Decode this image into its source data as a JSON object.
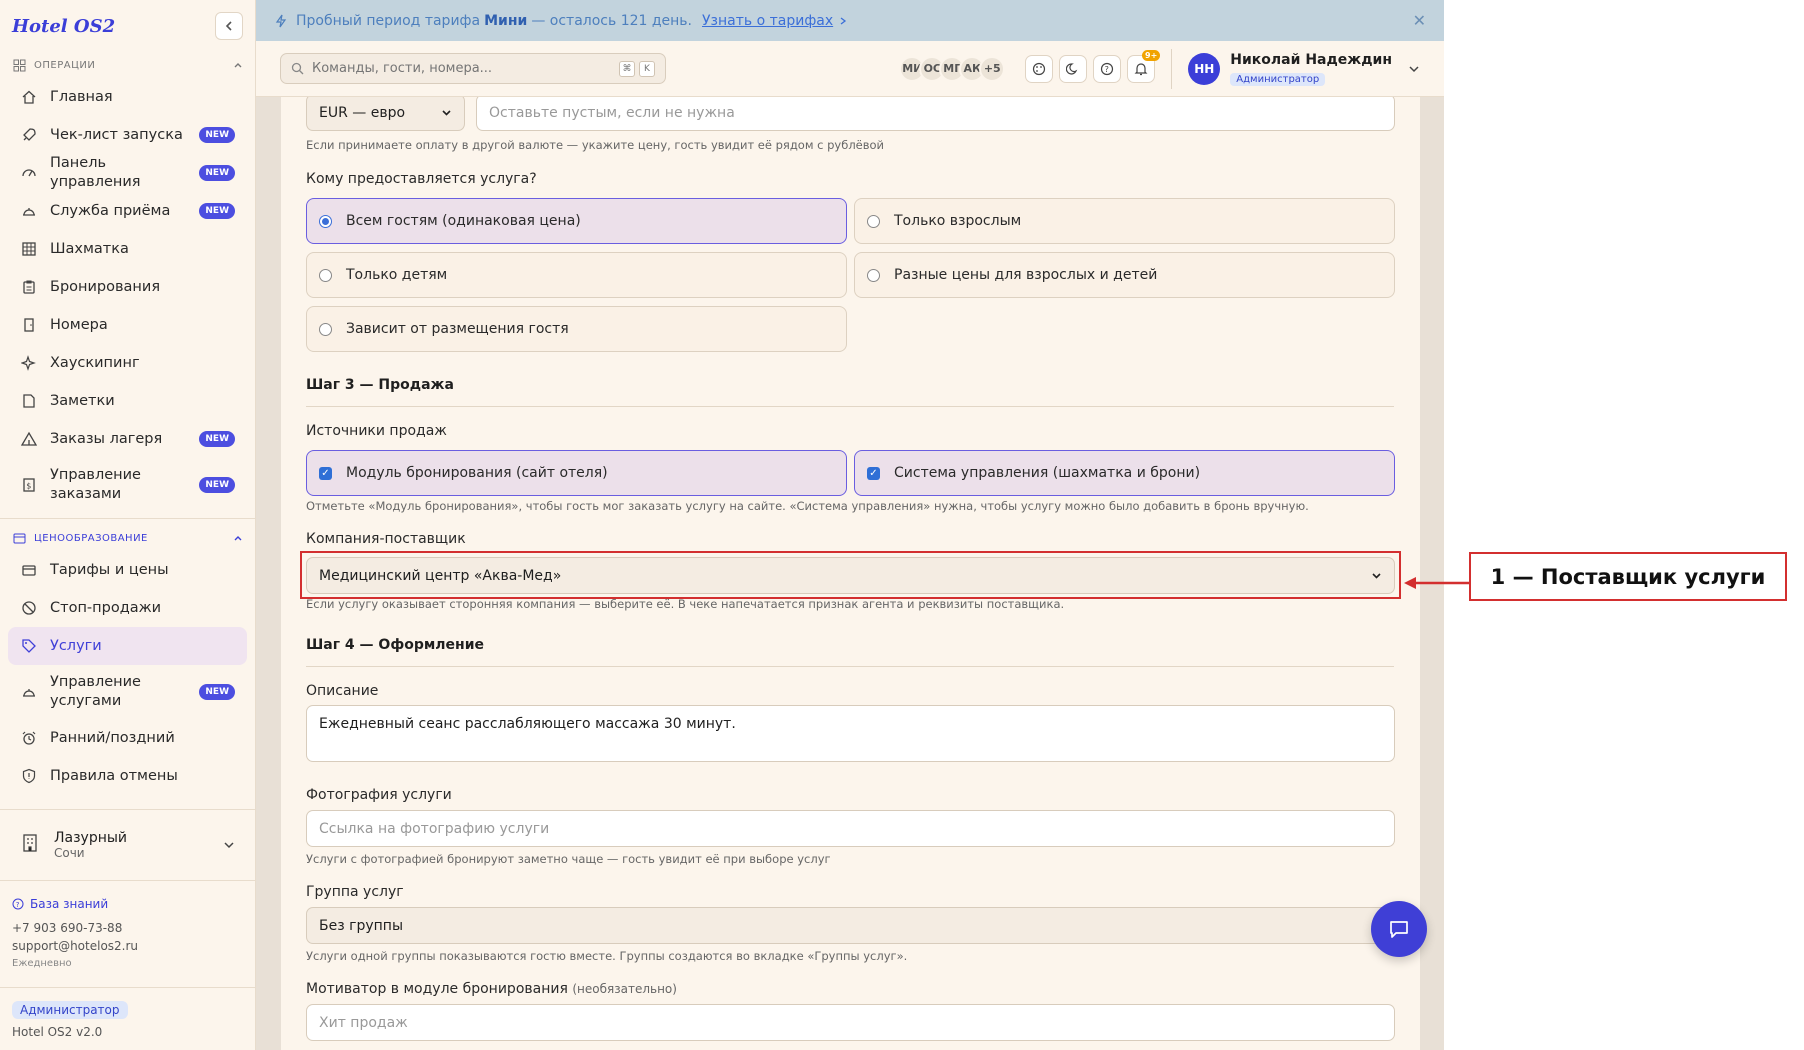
{
  "app": {
    "logo": "Hotel OS2"
  },
  "sidebar": {
    "sections": [
      {
        "title": "ОПЕРАЦИИ"
      },
      {
        "title": "ЦЕНООБРАЗОВАНИЕ"
      }
    ],
    "ops_items": [
      {
        "label": "Главная"
      },
      {
        "label": "Чек-лист запуска",
        "badge": "NEW"
      },
      {
        "label": "Панель управления",
        "badge": "NEW"
      },
      {
        "label": "Служба приёма",
        "badge": "NEW"
      },
      {
        "label": "Шахматка"
      },
      {
        "label": "Бронирования"
      },
      {
        "label": "Номера"
      },
      {
        "label": "Хаускипинг"
      },
      {
        "label": "Заметки"
      },
      {
        "label": "Заказы лагеря",
        "badge": "NEW"
      },
      {
        "label": "Управление заказами",
        "badge": "NEW"
      }
    ],
    "pricing_items": [
      {
        "label": "Тарифы и цены"
      },
      {
        "label": "Стоп-продажи"
      },
      {
        "label": "Услуги"
      },
      {
        "label": "Управление услугами",
        "badge": "NEW"
      },
      {
        "label": "Ранний/поздний"
      },
      {
        "label": "Правила отмены"
      }
    ],
    "hotel": {
      "name": "Лазурный",
      "city": "Сочи"
    },
    "support": {
      "kb": "База знаний",
      "phone": "+7 903 690-73-88",
      "email": "support@hotelos2.ru",
      "hours": "Ежедневно"
    },
    "role": "Администратор",
    "version": "Hotel OS2 v2.0"
  },
  "banner": {
    "prefix": "Пробный период тарифа",
    "plan": "Мини",
    "suffix": "— осталось 121 день.",
    "link": "Узнать о тарифах"
  },
  "header": {
    "search_placeholder": "Команды, гости, номера...",
    "kbd1": "⌘",
    "kbd2": "K",
    "avatars": [
      "МИ",
      "ОС",
      "МГ",
      "АК",
      "+5"
    ],
    "notif_count": "9+",
    "user": {
      "initials": "НН",
      "name": "Николай Надеждин",
      "role": "Администратор"
    }
  },
  "form": {
    "currency": "EUR — евро",
    "currency_price_placeholder": "Оставьте пустым, если не нужна",
    "currency_hint": "Если принимаете оплату в другой валюте — укажите цену, гость увидит её рядом с рублёвой",
    "audience_label": "Кому предоставляется услуга?",
    "audience_options": [
      "Всем гостям (одинаковая цена)",
      "Только взрослым",
      "Только детям",
      "Разные цены для взрослых и детей",
      "Зависит от размещения гостя"
    ],
    "step3": "Шаг 3 — Продажа",
    "sales_label": "Источники продаж",
    "sales_options": [
      "Модуль бронирования (сайт отеля)",
      "Система управления (шахматка и брони)"
    ],
    "sales_hint": "Отметьте «Модуль бронирования», чтобы гость мог заказать услугу на сайте. «Система управления» нужна, чтобы услугу можно было добавить в бронь вручную.",
    "supplier_label": "Компания-поставщик",
    "supplier_value": "Медицинский центр «Аква-Мед»",
    "supplier_hint": "Если услугу оказывает сторонняя компания — выберите её. В чеке напечатается признак агента и реквизиты поставщика.",
    "step4": "Шаг 4 — Оформление",
    "description_label": "Описание",
    "description_value": "Ежедневный сеанс расслабляющего массажа 30 минут.",
    "photo_label": "Фотография услуги",
    "photo_placeholder": "Ссылка на фотографию услуги",
    "photo_hint": "Услуги с фотографией бронируют заметно чаще — гость увидит её при выборе услуг",
    "group_label": "Группа услуг",
    "group_value": "Без группы",
    "group_hint": "Услуги одной группы показываются гостю вместе. Группы создаются во вкладке «Группы услуг».",
    "motivator_label": "Мотиватор в модуле бронирования",
    "motivator_optional": "(необязательно)",
    "motivator_placeholder": "Хит продаж"
  },
  "annotation": {
    "text": "1 — Поставщик услуги"
  },
  "colors": {
    "accent": "#3b3ed8",
    "callout": "#d32f2f",
    "sidebar_bg": "#fcf5ec"
  }
}
